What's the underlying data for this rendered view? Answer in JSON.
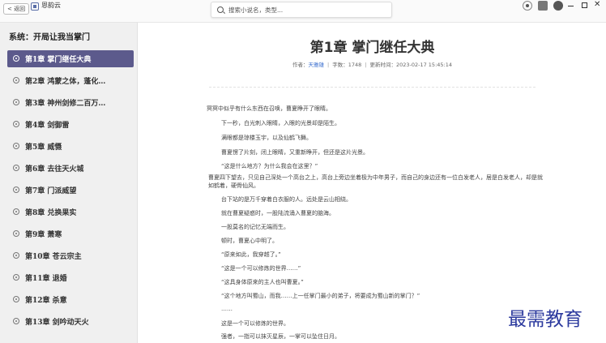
{
  "topbar": {
    "back_label": "< 返回",
    "app_name": "恩韵云",
    "search_placeholder": "搜索小说名，类型..."
  },
  "sidebar": {
    "book_title": "系统：开局让我当掌门",
    "chapters": [
      {
        "label": "第1章 掌门继任大典",
        "active": true
      },
      {
        "label": "第2章 鸿蒙之体，蓬化…",
        "active": false
      },
      {
        "label": "第3章 神州剑修二百万…",
        "active": false
      },
      {
        "label": "第4章 剑御雷",
        "active": false
      },
      {
        "label": "第5章 威慑",
        "active": false
      },
      {
        "label": "第6章 去往天火城",
        "active": false
      },
      {
        "label": "第7章 门派威望",
        "active": false
      },
      {
        "label": "第8章 兑换果实",
        "active": false
      },
      {
        "label": "第9章 萧寒",
        "active": false
      },
      {
        "label": "第10章 苍云宗主",
        "active": false
      },
      {
        "label": "第11章 退婚",
        "active": false
      },
      {
        "label": "第12章 杀意",
        "active": false
      },
      {
        "label": "第13章 剑吟动天火",
        "active": false
      }
    ]
  },
  "content": {
    "chapter_title": "第1章 掌门继任大典",
    "meta": {
      "author_label": "作者：",
      "author": "天雅雄",
      "word_label": "字数：",
      "word_count": "1748",
      "updated_label": "更新时间：",
      "updated": "2023-02-17 15:45:14"
    },
    "paragraphs": [
      "冥冥中似乎有什么东西在召唤，曹夏睁开了眼睛。",
      "下一秒，白光刺入眼睛，入眼的光景却是陌生。",
      "满眼都是琼楼玉宇，以及仙鹤飞舞。",
      "曹夏愣了片刻，闭上眼睛，又重新睁开，但还是这片光景。",
      "“这是什么地方？为什么我会在这里？”",
      "曹夏四下望去，只见自己深处一个高台之上，高台上旁边坐着极为中年男子，而自己的身边还有一位白发老人，居是白发老人，却是就如鹤着，硬骨仙风。",
      "台下站的是万千穿着白衣服的人。远处是云山相绕。",
      "就在曹夏疑惑时，一股陆流涌入曹夏的脑海。",
      "一股莫名的记忆无端而生。",
      "顿时，曹夏心中明了。",
      "“原来如此，我穿越了。”",
      "“这是一个可以修炼的世界……”",
      "“这具身体原来的主人也叫曹夏。”",
      "“这个地方叫蜀山，而我……上一任掌门最小的弟子，将要成为蜀山新的掌门？”",
      "……",
      "这是一个可以修炼的世界。",
      "强者，一指可以抹灭星辰，一掌可以坠住日月。"
    ]
  },
  "watermark": "最需教育"
}
